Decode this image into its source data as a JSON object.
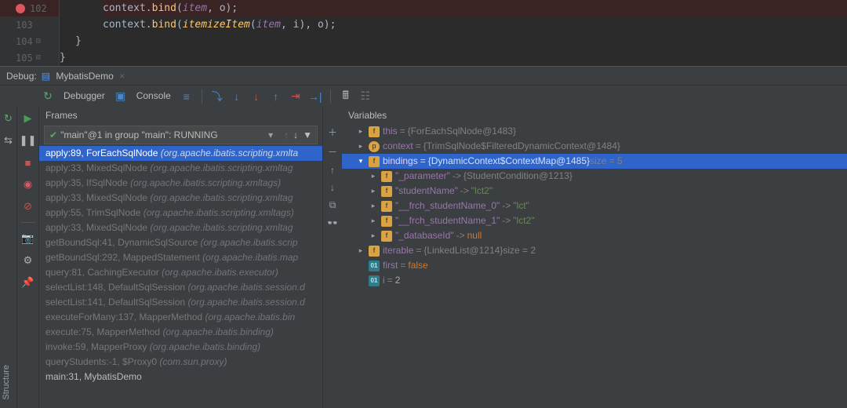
{
  "code": {
    "lines": [
      102,
      103,
      104,
      105
    ],
    "l102": "context.bind(item, o);",
    "l103_pre": "context.bind(",
    "l103_fn": "itemizeItem",
    "l103_args": "(item, i), o);",
    "brace": "}"
  },
  "debug": {
    "label": "Debug:",
    "config_name": "MybatisDemo",
    "tab_debugger": "Debugger",
    "tab_console": "Console"
  },
  "frames": {
    "header": "Frames",
    "thread": "\"main\"@1 in group \"main\": RUNNING",
    "rows": [
      {
        "m": "apply:89, ForEachSqlNode",
        "p": "(org.apache.ibatis.scripting.xmlta",
        "sel": true
      },
      {
        "m": "apply:33, MixedSqlNode",
        "p": "(org.apache.ibatis.scripting.xmltag"
      },
      {
        "m": "apply:35, IfSqlNode",
        "p": "(org.apache.ibatis.scripting.xmltags)"
      },
      {
        "m": "apply:33, MixedSqlNode",
        "p": "(org.apache.ibatis.scripting.xmltag"
      },
      {
        "m": "apply:55, TrimSqlNode",
        "p": "(org.apache.ibatis.scripting.xmltags)"
      },
      {
        "m": "apply:33, MixedSqlNode",
        "p": "(org.apache.ibatis.scripting.xmltag"
      },
      {
        "m": "getBoundSql:41, DynamicSqlSource",
        "p": "(org.apache.ibatis.scrip"
      },
      {
        "m": "getBoundSql:292, MappedStatement",
        "p": "(org.apache.ibatis.map"
      },
      {
        "m": "query:81, CachingExecutor",
        "p": "(org.apache.ibatis.executor)"
      },
      {
        "m": "selectList:148, DefaultSqlSession",
        "p": "(org.apache.ibatis.session.d"
      },
      {
        "m": "selectList:141, DefaultSqlSession",
        "p": "(org.apache.ibatis.session.d"
      },
      {
        "m": "executeForMany:137, MapperMethod",
        "p": "(org.apache.ibatis.bin"
      },
      {
        "m": "execute:75, MapperMethod",
        "p": "(org.apache.ibatis.binding)"
      },
      {
        "m": "invoke:59, MapperProxy",
        "p": "(org.apache.ibatis.binding)"
      },
      {
        "m": "queryStudents:-1, $Proxy0",
        "p": "(com.sun.proxy)"
      },
      {
        "m": "main:31, MybatisDemo",
        "p": "",
        "bottom": true
      }
    ]
  },
  "variables": {
    "header": "Variables",
    "rows": [
      {
        "d": 0,
        "c": "r",
        "b": "f",
        "n": "this",
        "eq": " = ",
        "v": "{ForEachSqlNode@1483}"
      },
      {
        "d": 0,
        "c": "r",
        "b": "p",
        "n": "context",
        "eq": " = ",
        "v": "{TrimSqlNode$FilteredDynamicContext@1484}"
      },
      {
        "d": 0,
        "c": "d",
        "b": "f",
        "n": "bindings",
        "eq": " = ",
        "v": "{DynamicContext$ContextMap@1485}",
        "extra": "  size = 5",
        "sel": true
      },
      {
        "d": 1,
        "c": "r",
        "b": "f",
        "n": "\"_parameter\"",
        "arrow": " -> ",
        "v": "{StudentCondition@1213}"
      },
      {
        "d": 1,
        "c": "r",
        "b": "f",
        "n": "\"studentName\"",
        "arrow": " -> ",
        "str": "\"lct2\""
      },
      {
        "d": 1,
        "c": "r",
        "b": "f",
        "n": "\"__frch_studentName_0\"",
        "arrow": " -> ",
        "str": "\"lct\""
      },
      {
        "d": 1,
        "c": "r",
        "b": "f",
        "n": "\"__frch_studentName_1\"",
        "arrow": " -> ",
        "str": "\"lct2\""
      },
      {
        "d": 1,
        "c": "r",
        "b": "f",
        "n": "\"_databaseId\"",
        "arrow": " -> ",
        "kw": "null"
      },
      {
        "d": 0,
        "c": "r",
        "b": "f",
        "n": "iterable",
        "eq": " = ",
        "v": "{LinkedList@1214}",
        "extra": "  size = 2"
      },
      {
        "d": 0,
        "c": "",
        "b": "01",
        "n": "first",
        "eq": " = ",
        "kw": "false"
      },
      {
        "d": 0,
        "c": "",
        "b": "01",
        "n": "i",
        "eq": " = ",
        "num": "2"
      }
    ]
  },
  "structure_tab": "Structure",
  "chart_data": null
}
